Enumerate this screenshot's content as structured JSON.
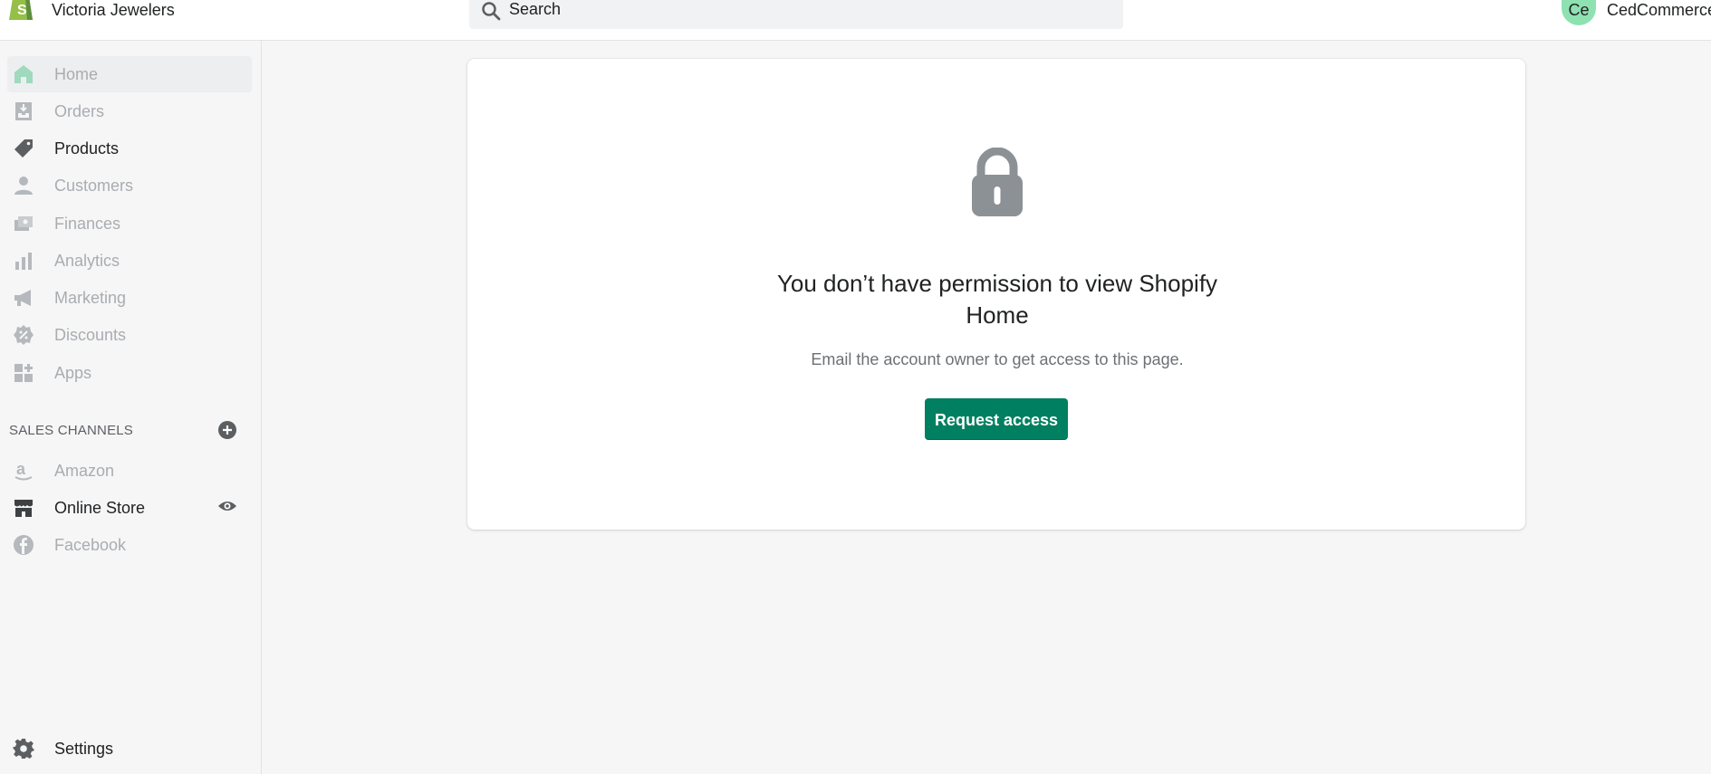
{
  "store": {
    "name": "Victoria Jewelers"
  },
  "search": {
    "placeholder": "Search"
  },
  "user": {
    "initials": "Ce",
    "name": "CedCommerce"
  },
  "sidebar": {
    "items": [
      {
        "label": "Home",
        "icon": "home-icon"
      },
      {
        "label": "Orders",
        "icon": "orders-icon"
      },
      {
        "label": "Products",
        "icon": "tag-icon"
      },
      {
        "label": "Customers",
        "icon": "person-icon"
      },
      {
        "label": "Finances",
        "icon": "finances-icon"
      },
      {
        "label": "Analytics",
        "icon": "bar-chart-icon"
      },
      {
        "label": "Marketing",
        "icon": "megaphone-icon"
      },
      {
        "label": "Discounts",
        "icon": "discount-icon"
      },
      {
        "label": "Apps",
        "icon": "apps-icon"
      }
    ],
    "sales_channels_title": "SALES CHANNELS",
    "channels": [
      {
        "label": "Amazon",
        "icon": "amazon-icon"
      },
      {
        "label": "Online Store",
        "icon": "store-icon"
      },
      {
        "label": "Facebook",
        "icon": "facebook-icon"
      }
    ],
    "settings_label": "Settings"
  },
  "main": {
    "heading": "You don’t have permission to view Shopify Home",
    "subtext": "Email the account owner to get access to this page.",
    "button_label": "Request access"
  },
  "colors": {
    "accent": "#008060",
    "avatar": "#8ee1b1",
    "logo": "#95bf47"
  }
}
